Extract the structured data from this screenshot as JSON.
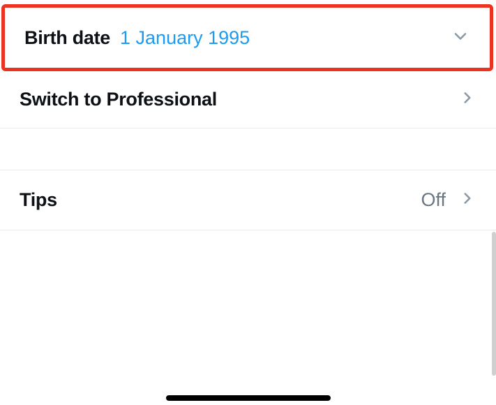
{
  "rows": {
    "birthdate": {
      "label": "Birth date",
      "value": "1 January 1995"
    },
    "professional": {
      "label": "Switch to Professional"
    },
    "tips": {
      "label": "Tips",
      "status": "Off"
    }
  },
  "colors": {
    "highlight": "#ea3321",
    "link": "#1d9bf0",
    "muted": "#6b7680",
    "chevron": "#8b98a5"
  }
}
